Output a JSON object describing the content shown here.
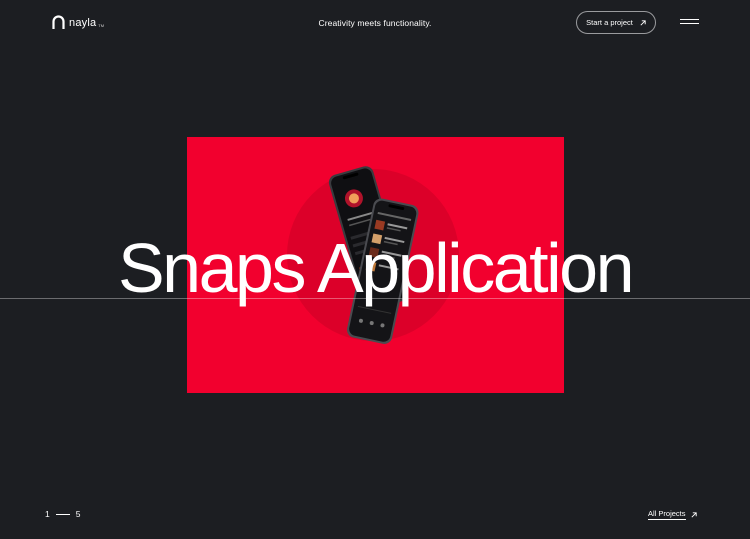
{
  "header": {
    "logo_text": "nayla",
    "logo_tm": "TM",
    "tagline": "Creativity meets functionality.",
    "cta_label": "Start a project",
    "cta_icon": "arrow-up-right-icon",
    "menu_icon": "hamburger-menu-icon"
  },
  "hero": {
    "title": "Snaps Application",
    "card_color": "#f2002e",
    "background_color": "#1c1e22"
  },
  "footer": {
    "pager_current": "1",
    "pager_total": "5",
    "all_projects_label": "All Projects",
    "all_projects_icon": "arrow-up-right-icon"
  }
}
